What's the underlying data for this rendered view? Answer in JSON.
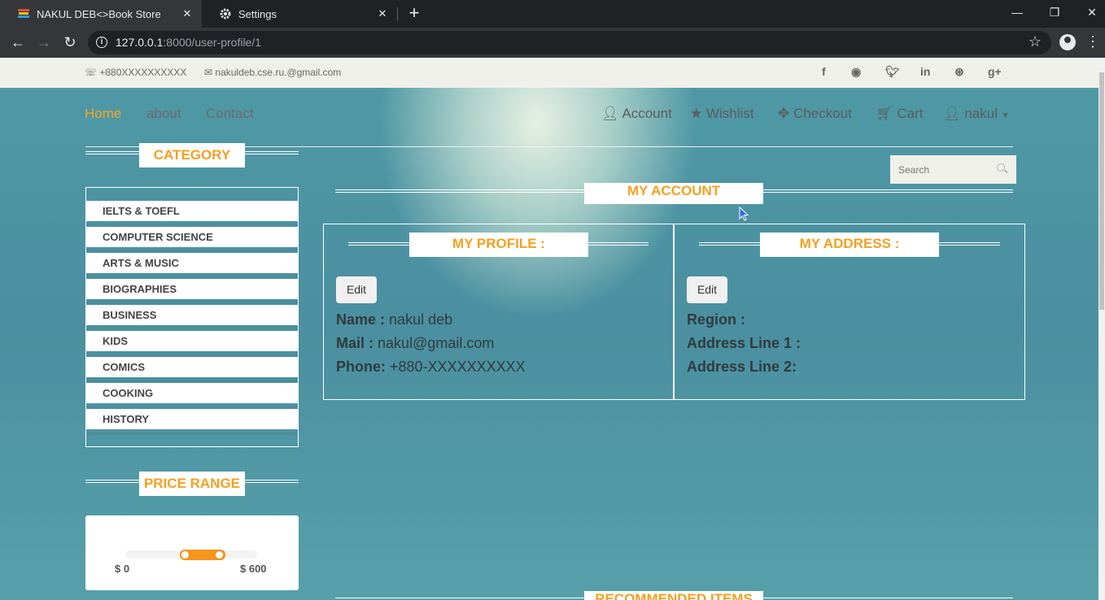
{
  "browser": {
    "tabs": [
      {
        "title": "NAKUL DEB<>Book Store",
        "active": true
      },
      {
        "title": "Settings",
        "active": false
      }
    ],
    "url_host": "127.0.0.1",
    "url_rest": ":8000/user-profile/1"
  },
  "topbar": {
    "phone": "+880XXXXXXXXXX",
    "email": "nakuldeb.cse.ru.@gmail.com",
    "social_icons": [
      "facebook-icon",
      "github-icon",
      "twitter-icon",
      "linkedin-icon",
      "dribbble-icon",
      "google-plus-icon"
    ]
  },
  "nav": {
    "left": [
      "Home",
      "about",
      "Contact"
    ],
    "account": "Account",
    "wishlist": "Wishlist",
    "checkout": "Checkout",
    "cart": "Cart",
    "user": "nakul"
  },
  "sidebar": {
    "category_title": "CATEGORY",
    "categories": [
      "IELTS & TOEFL",
      "COMPUTER SCIENCE",
      "ARTS & MUSIC",
      "BIOGRAPHIES",
      "BUSINESS",
      "KIDS",
      "COMICS",
      "COOKING",
      "HISTORY"
    ],
    "price_title": "PRICE RANGE",
    "price_min": "$ 0",
    "price_max": "$ 600"
  },
  "search": {
    "placeholder": "Search"
  },
  "main": {
    "title": "MY ACCOUNT",
    "profile": {
      "title": "MY PROFILE :",
      "edit": "Edit",
      "name_label": "Name :",
      "name": "nakul deb",
      "mail_label": "Mail :",
      "mail": "nakul@gmail.com",
      "phone_label": "Phone:",
      "phone": "+880-XXXXXXXXXX"
    },
    "address": {
      "title": "MY ADDRESS :",
      "edit": "Edit",
      "region_label": "Region :",
      "line1_label": "Address Line 1 :",
      "line2_label": "Address Line 2:"
    },
    "recommended_title": "RECOMMENDED ITEMS"
  },
  "colors": {
    "accent": "#f5a021",
    "page_bg": "#4e97a3"
  }
}
